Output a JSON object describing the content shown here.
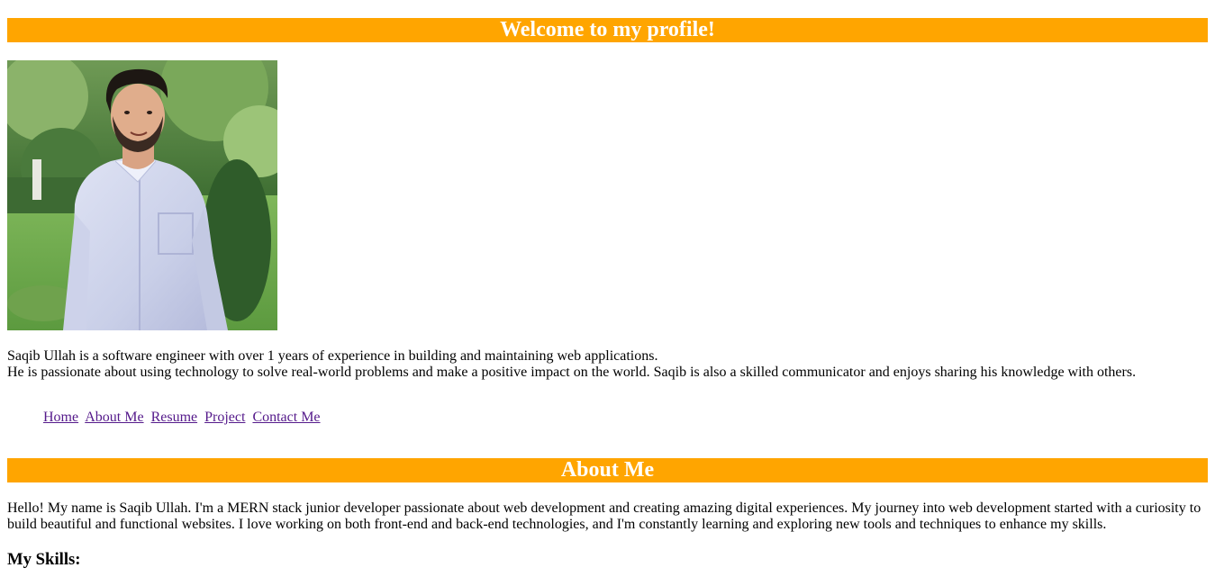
{
  "header": {
    "title": "Welcome to my profile!"
  },
  "profile": {
    "photo_alt": "Saqib Ullah",
    "bio_line_1": "Saqib Ullah is a software engineer with over 1 years of experience in building and maintaining web applications.",
    "bio_line_2": "He is passionate about using technology to solve real-world problems and make a positive impact on the world. Saqib is also a skilled communicator and enjoys sharing his knowledge with others."
  },
  "nav": {
    "items": [
      {
        "label": "Home"
      },
      {
        "label": "About Me"
      },
      {
        "label": "Resume"
      },
      {
        "label": "Project"
      },
      {
        "label": "Contact Me"
      }
    ]
  },
  "about": {
    "title": "About Me",
    "text": "Hello! My name is Saqib Ullah. I'm a MERN stack junior developer passionate about web development and creating amazing digital experiences. My journey into web development started with a curiosity to build beautiful and functional websites. I love working on both front-end and back-end technologies, and I'm constantly learning and exploring new tools and techniques to enhance my skills.",
    "skills_heading": "My Skills:"
  },
  "colors": {
    "banner": "#ffa500",
    "banner_text": "#ffffff",
    "link_visited": "#551a8b"
  }
}
